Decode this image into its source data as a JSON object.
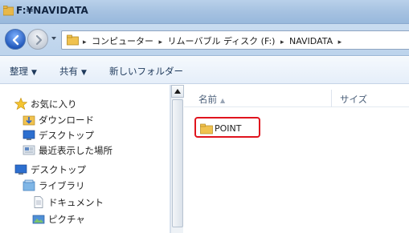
{
  "window": {
    "title": "F:¥NAVIDATA"
  },
  "address": {
    "crumbs": [
      "コンピューター",
      "リムーバブル ディスク (F:)",
      "NAVIDATA"
    ]
  },
  "toolbar": {
    "organize": "整理",
    "share": "共有",
    "new_folder": "新しいフォルダー"
  },
  "nav": {
    "favorites": "お気に入り",
    "downloads": "ダウンロード",
    "desktop_fav": "デスクトップ",
    "recent": "最近表示した場所",
    "desktop": "デスクトップ",
    "libraries": "ライブラリ",
    "documents": "ドキュメント",
    "pictures": "ピクチャ"
  },
  "columns": {
    "name": "名前",
    "size": "サイズ"
  },
  "files": [
    {
      "name": "POINT",
      "type": "folder"
    }
  ],
  "colors": {
    "highlight": "#e0141e",
    "accent": "#1e55b8"
  }
}
